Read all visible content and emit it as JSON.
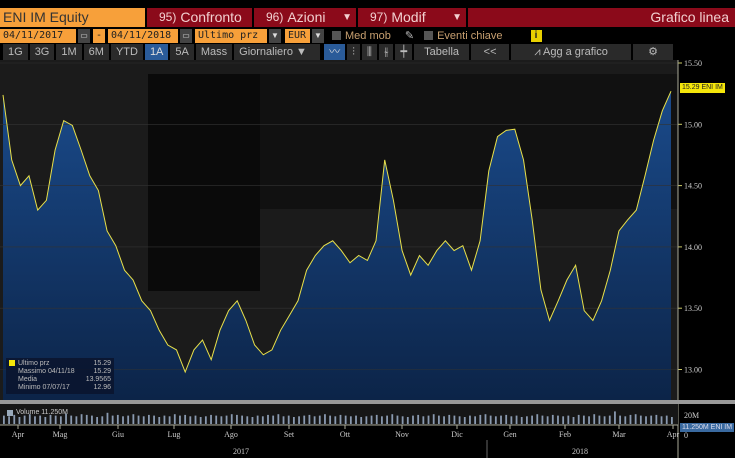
{
  "header": {
    "ticker": "ENI IM Equity",
    "compare": {
      "num": "95)",
      "label": "Confronto"
    },
    "actions": {
      "num": "96)",
      "label": "Azioni"
    },
    "modify": {
      "num": "97)",
      "label": "Modif"
    },
    "title": "Grafico linea"
  },
  "controls": {
    "start_date": "04/11/2017",
    "end_date": "04/11/2018",
    "separator": "-",
    "field": "Ultimo prz",
    "currency": "EUR",
    "moving_avg": "Med mob",
    "key_events": "Eventi chiave",
    "info": "i"
  },
  "toolbar": {
    "ranges": [
      "1G",
      "3G",
      "1M",
      "6M",
      "YTD",
      "1A",
      "5A",
      "Mass"
    ],
    "active_range": "1A",
    "period": "Giornaliero",
    "table": "Tabella",
    "collapse": "<<",
    "add_to_chart": "Agg a grafico"
  },
  "legend": {
    "rows": [
      {
        "label": "Ultimo prz",
        "value": "15.29"
      },
      {
        "label": "Massimo 04/11/18",
        "value": "15.29"
      },
      {
        "label": "Media",
        "value": "13.9565"
      },
      {
        "label": "Minimo 07/07/17",
        "value": "12.96"
      }
    ]
  },
  "volume": {
    "label": "Volume 11.250M",
    "last_tag": "11.250M ENI IM",
    "tick": "20M",
    "zero": "0"
  },
  "price_tag": "15.29 ENI IM",
  "colors": {
    "line": "#e8e04a",
    "fill": "#123a70",
    "accent": "#f7a03a",
    "header": "#8b0a1a"
  },
  "chart_data": {
    "type": "area",
    "ylim": [
      12.8,
      15.55
    ],
    "yticks": [
      "15.50",
      "15.00",
      "14.50",
      "14.00",
      "13.50",
      "13.00"
    ],
    "ytick_values": [
      15.5,
      15.0,
      14.5,
      14.0,
      13.5,
      13.0
    ],
    "months": [
      "Apr",
      "Mag",
      "Giu",
      "Lug",
      "Ago",
      "Set",
      "Ott",
      "Nov",
      "Dic",
      "Gen",
      "Feb",
      "Mar",
      "Apr"
    ],
    "years": [
      "2017",
      "2018"
    ],
    "values": [
      15.24,
      14.71,
      14.5,
      14.58,
      14.3,
      14.38,
      14.79,
      15.03,
      14.99,
      14.79,
      14.58,
      14.46,
      14.13,
      14.01,
      13.81,
      13.73,
      13.56,
      13.48,
      13.32,
      13.2,
      13.16,
      12.98,
      13.16,
      13.24,
      13.08,
      13.32,
      13.48,
      13.56,
      13.4,
      13.2,
      13.12,
      13.16,
      13.32,
      13.44,
      13.56,
      13.81,
      13.93,
      14.01,
      14.05,
      13.97,
      13.87,
      13.93,
      13.89,
      14.05,
      14.71,
      14.38,
      13.97,
      13.77,
      13.93,
      13.85,
      13.97,
      14.05,
      13.97,
      14.01,
      13.81,
      14.05,
      14.62,
      14.9,
      14.95,
      14.96,
      14.71,
      14.22,
      13.65,
      13.4,
      13.56,
      13.73,
      13.85,
      13.48,
      13.4,
      13.56,
      13.81,
      14.13,
      14.22,
      14.3,
      14.58,
      14.87,
      15.11,
      15.27
    ],
    "volumes": [
      12,
      11,
      13,
      10,
      12,
      14,
      11,
      12,
      10,
      13,
      12,
      11,
      15,
      12,
      11,
      14,
      13,
      12,
      10,
      11,
      16,
      12,
      13,
      11,
      12,
      14,
      12,
      11,
      13,
      12,
      10,
      12,
      11,
      14,
      12,
      13,
      11,
      12,
      10,
      11,
      13,
      12,
      11,
      12,
      14,
      13,
      12,
      11,
      10,
      12,
      11,
      13,
      12,
      14,
      11,
      12,
      10,
      11,
      12,
      13,
      11,
      12,
      14,
      12,
      11,
      13,
      12,
      11,
      12,
      10,
      11,
      12,
      13,
      11,
      12,
      14,
      12,
      11,
      10,
      12,
      13,
      11,
      12,
      14,
      12,
      11,
      13,
      12,
      11,
      10,
      12,
      11,
      13,
      14,
      12,
      11,
      12,
      13,
      11,
      12,
      10,
      11,
      12,
      14,
      12,
      11,
      13,
      12,
      11,
      12,
      10,
      13,
      12,
      11,
      14,
      12,
      11,
      12,
      18,
      12,
      11,
      13,
      14,
      12,
      11,
      12,
      13,
      11,
      12,
      10
    ]
  }
}
